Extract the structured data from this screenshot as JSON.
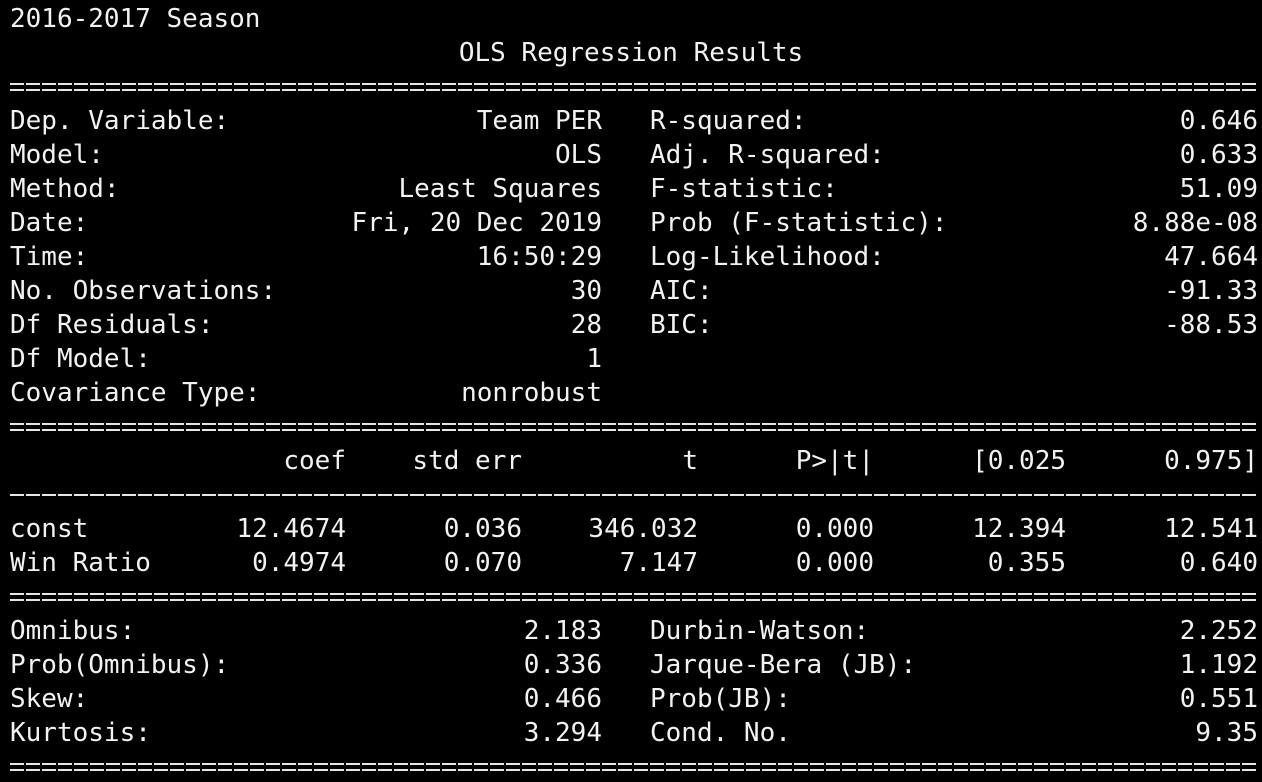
{
  "season_label": "2016-2017 Season",
  "summary_title": "OLS Regression Results",
  "model_info": {
    "left": [
      {
        "label": "Dep. Variable:",
        "value": "Team PER"
      },
      {
        "label": "Model:",
        "value": "OLS"
      },
      {
        "label": "Method:",
        "value": "Least Squares"
      },
      {
        "label": "Date:",
        "value": "Fri, 20 Dec 2019"
      },
      {
        "label": "Time:",
        "value": "16:50:29"
      },
      {
        "label": "No. Observations:",
        "value": "30"
      },
      {
        "label": "Df Residuals:",
        "value": "28"
      },
      {
        "label": "Df Model:",
        "value": "1"
      },
      {
        "label": "Covariance Type:",
        "value": "nonrobust"
      }
    ],
    "right": [
      {
        "label": "R-squared:",
        "value": "0.646"
      },
      {
        "label": "Adj. R-squared:",
        "value": "0.633"
      },
      {
        "label": "F-statistic:",
        "value": "51.09"
      },
      {
        "label": "Prob (F-statistic):",
        "value": "8.88e-08"
      },
      {
        "label": "Log-Likelihood:",
        "value": "47.664"
      },
      {
        "label": "AIC:",
        "value": "-91.33"
      },
      {
        "label": "BIC:",
        "value": "-88.53"
      }
    ]
  },
  "coef_table": {
    "headers": [
      "coef",
      "std err",
      "t",
      "P>|t|",
      "[0.025",
      "0.975]"
    ],
    "rows": [
      {
        "name": "const",
        "values": [
          "12.4674",
          "0.036",
          "346.032",
          "0.000",
          "12.394",
          "12.541"
        ]
      },
      {
        "name": "Win Ratio",
        "values": [
          "0.4974",
          "0.070",
          "7.147",
          "0.000",
          "0.355",
          "0.640"
        ]
      }
    ]
  },
  "diagnostics": {
    "left": [
      {
        "label": "Omnibus:",
        "value": "2.183"
      },
      {
        "label": "Prob(Omnibus):",
        "value": "0.336"
      },
      {
        "label": "Skew:",
        "value": "0.466"
      },
      {
        "label": "Kurtosis:",
        "value": "3.294"
      }
    ],
    "right": [
      {
        "label": "Durbin-Watson:",
        "value": "2.252"
      },
      {
        "label": "Jarque-Bera (JB):",
        "value": "1.192"
      },
      {
        "label": "Prob(JB):",
        "value": "0.551"
      },
      {
        "label": "Cond. No.",
        "value": "9.35"
      }
    ]
  },
  "colors": {
    "background": "#000000",
    "text": "#f2f2f2"
  }
}
